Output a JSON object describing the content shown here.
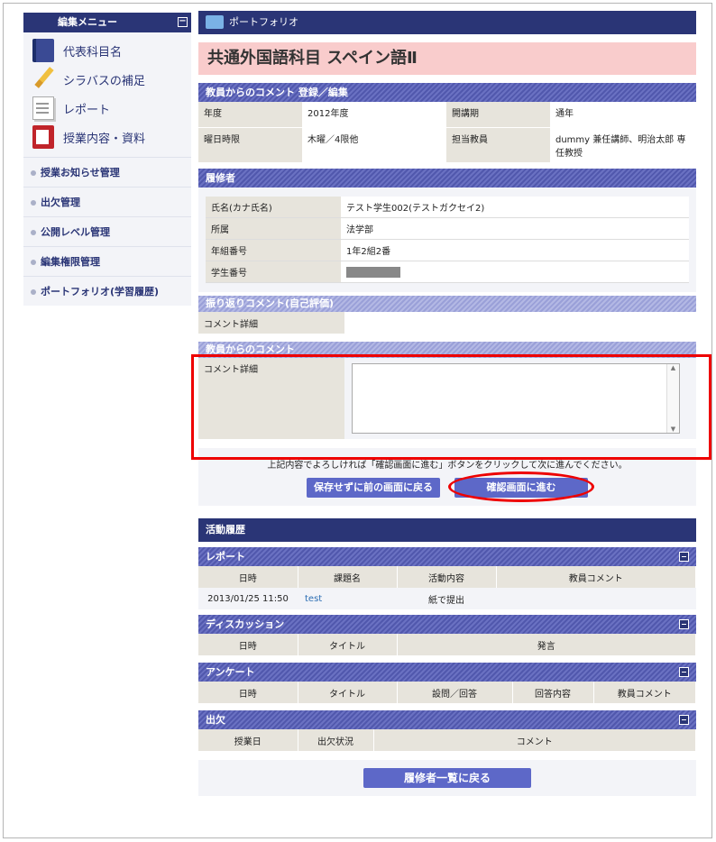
{
  "sidebar": {
    "header": "編集メニュー",
    "collapse_symbol": "−",
    "icon_items": [
      {
        "label": "代表科目名",
        "icon": "book-icon"
      },
      {
        "label": "シラバスの補足",
        "icon": "pencil-icon"
      },
      {
        "label": "レポート",
        "icon": "document-icon"
      },
      {
        "label": "授業内容・資料",
        "icon": "folder-icon"
      }
    ],
    "links": [
      "授業お知らせ管理",
      "出欠管理",
      "公開レベル管理",
      "編集権限管理",
      "ポートフォリオ(学習履歴)"
    ]
  },
  "main": {
    "breadcrumb": "ポートフォリオ",
    "title": "共通外国語科目 スペイン語Ⅱ",
    "teacher_comment_section": "教員からのコメント 登録／編集",
    "course_info": {
      "year_label": "年度",
      "year": "2012年度",
      "term_label": "開講期",
      "term": "通年",
      "schedule_label": "曜日時限",
      "schedule": "木曜／4限他",
      "teacher_label": "担当教員",
      "teacher": "dummy 兼任講師、明治太郎 専任教授"
    },
    "student_section": "履修者",
    "student": {
      "name_label": "氏名(カナ氏名)",
      "name": "テスト学生002(テストガクセイ2)",
      "dept_label": "所属",
      "dept": "法学部",
      "grade_label": "年組番号",
      "grade": "1年2組2番",
      "id_label": "学生番号"
    },
    "self_eval_section": "振り返りコメント(自己評価)",
    "self_eval_label": "コメント詳細",
    "teacher_comment_head": "教員からのコメント",
    "teacher_comment_label": "コメント詳細",
    "teacher_comment_value": "",
    "instruction": "上記内容でよろしければ「確認画面に進む」ボタンをクリックして次に進んでください。",
    "btn_back": "保存せずに前の画面に戻る",
    "btn_confirm": "確認画面に進む",
    "history_title": "活動履歴",
    "report": {
      "title": "レポート",
      "headers": [
        "日時",
        "課題名",
        "活動内容",
        "教員コメント"
      ],
      "rows": [
        [
          "2013/01/25 11:50",
          "test",
          "紙で提出",
          ""
        ]
      ]
    },
    "discussion": {
      "title": "ディスカッション",
      "headers": [
        "日時",
        "タイトル",
        "発言"
      ]
    },
    "survey": {
      "title": "アンケート",
      "headers": [
        "日時",
        "タイトル",
        "設問／回答",
        "回答内容",
        "教員コメント"
      ]
    },
    "attendance": {
      "title": "出欠",
      "headers": [
        "授業日",
        "出欠状況",
        "コメント"
      ]
    },
    "btn_list": "履修者一覧に戻る"
  }
}
